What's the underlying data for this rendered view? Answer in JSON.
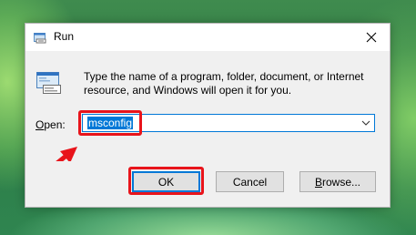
{
  "window": {
    "title": "Run",
    "title_icon": "run-icon",
    "close_icon": "close-icon"
  },
  "dialog": {
    "app_icon": "run-program-icon",
    "description_line1": "Type the name of a program, folder, document, or Internet",
    "description_line2": "resource, and Windows will open it for you.",
    "open_label_mnemonic": "O",
    "open_label_rest": "pen:",
    "open_value": "msconfig",
    "dropdown_icon": "chevron-down-icon"
  },
  "buttons": {
    "ok": "OK",
    "cancel": "Cancel",
    "browse_mnemonic": "B",
    "browse_rest": "rowse..."
  },
  "annotation": {
    "color": "#e8141b",
    "arrow_icon": "red-pointer-arrow-icon"
  },
  "colors": {
    "accent": "#0078d7",
    "button_bg": "#e1e1e1",
    "dialog_bg": "#f0f0f0"
  }
}
